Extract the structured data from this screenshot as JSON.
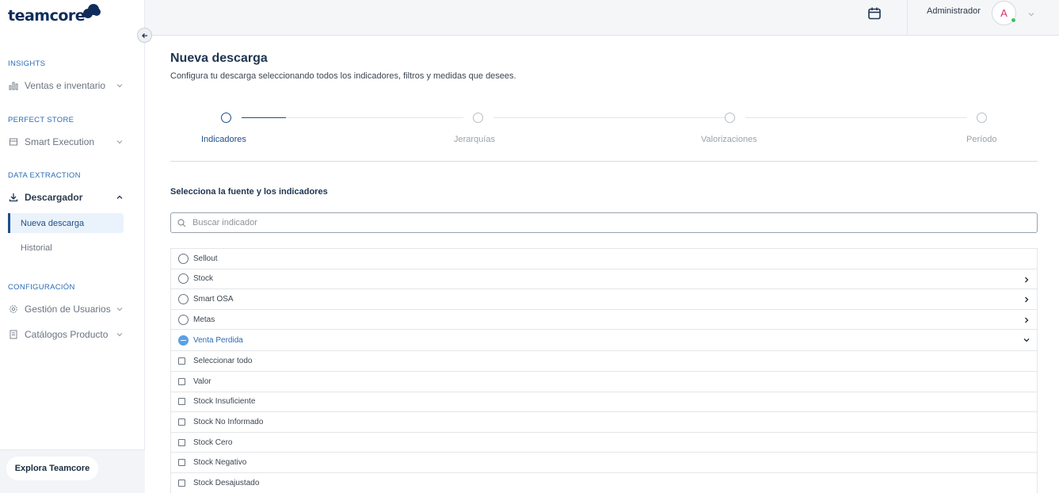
{
  "brand": {
    "logo_text": "teamcore"
  },
  "topbar": {
    "user_name": "Administrador",
    "avatar_initial": "A",
    "status_color": "#3ac35a"
  },
  "sidebar": {
    "sections": [
      {
        "title": "INSIGHTS",
        "items": [
          {
            "label": "Ventas e inventario",
            "icon": "bar-chart-icon"
          }
        ]
      },
      {
        "title": "PERFECT STORE",
        "items": [
          {
            "label": "Smart Execution",
            "icon": "store-icon"
          }
        ]
      },
      {
        "title": "DATA EXTRACTION",
        "items": [
          {
            "label": "Descargador",
            "icon": "download-icon",
            "expanded": true,
            "children": [
              {
                "label": "Nueva descarga",
                "active": true
              },
              {
                "label": "Historial",
                "active": false
              }
            ]
          }
        ]
      },
      {
        "title": "CONFIGURACIÓN",
        "items": [
          {
            "label": "Gestión de Usuarios",
            "icon": "gear-icon"
          },
          {
            "label": "Catálogos Producto",
            "icon": "catalog-icon"
          }
        ]
      }
    ],
    "footer_button": "Explora Teamcore"
  },
  "main": {
    "title": "Nueva descarga",
    "subtitle": "Configura tu descarga seleccionando todos los indicadores, filtros y medidas que desees.",
    "steps": [
      {
        "label": "Indicadores",
        "active": true
      },
      {
        "label": "Jerarquías",
        "active": false
      },
      {
        "label": "Valorizaciones",
        "active": false
      },
      {
        "label": "Período",
        "active": false
      }
    ],
    "section_title": "Selecciona la fuente y los indicadores",
    "search_placeholder": "Buscar indicador",
    "sources": [
      {
        "label": "Sellout",
        "selected": false,
        "expandable": false
      },
      {
        "label": "Stock",
        "selected": false,
        "expandable": true
      },
      {
        "label": "Smart OSA",
        "selected": false,
        "expandable": true
      },
      {
        "label": "Metas",
        "selected": false,
        "expandable": true
      },
      {
        "label": "Venta Perdida",
        "selected": true,
        "expanded": true
      }
    ],
    "indicators": [
      "Seleccionar todo",
      "Valor",
      "Stock Insuficiente",
      "Stock No Informado",
      "Stock Cero",
      "Stock Negativo",
      "Stock Desajustado"
    ]
  },
  "colors": {
    "brand_navy": "#0f2d5b",
    "accent_blue": "#1d4f8a",
    "selected_radio": "#5aa0e6"
  }
}
